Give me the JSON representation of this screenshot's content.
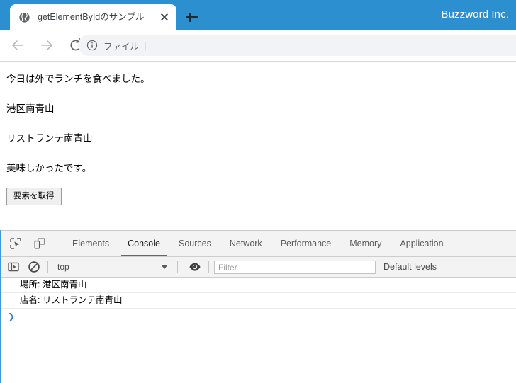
{
  "browser": {
    "brand_label": "Buzzword Inc.",
    "brand_color": "#2b8fd0",
    "tab": {
      "title": "getElementByIdのサンプル",
      "favicon": "globe-icon",
      "close": "close-icon"
    },
    "new_tab_label": "+",
    "toolbar": {
      "back": "back-arrow-icon",
      "forward": "forward-arrow-icon",
      "reload": "reload-icon",
      "omnibox": {
        "security_icon": "info-circle-icon",
        "scheme_text": "ファイル",
        "separator": "|",
        "value": ""
      }
    }
  },
  "page": {
    "paragraphs": [
      "今日は外でランチを食べました。",
      "港区南青山",
      "リストランテ南青山",
      "美味しかったです。"
    ],
    "button_label": "要素を取得"
  },
  "devtools": {
    "inspect_icon": "inspect-element-icon",
    "device_icon": "device-toolbar-icon",
    "tabs": [
      {
        "label": "Elements",
        "active": false
      },
      {
        "label": "Console",
        "active": true
      },
      {
        "label": "Sources",
        "active": false
      },
      {
        "label": "Network",
        "active": false
      },
      {
        "label": "Performance",
        "active": false
      },
      {
        "label": "Memory",
        "active": false
      },
      {
        "label": "Application",
        "active": false
      }
    ],
    "active_tab_underline_color": "#1a73e8",
    "console_toolbar": {
      "sidebar_icon": "console-sidebar-icon",
      "clear_icon": "clear-console-icon",
      "context_value": "top",
      "context_arrow": "chevron-down-icon",
      "eye_icon": "live-expression-eye-icon",
      "filter_placeholder": "Filter",
      "filter_value": "",
      "levels_label": "Default levels"
    },
    "console_messages": [
      "場所:  港区南青山",
      "店名:  リストランテ南青山"
    ],
    "prompt_caret": "❯"
  }
}
